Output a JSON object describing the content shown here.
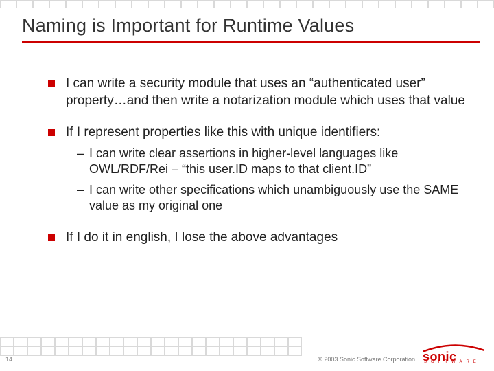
{
  "title": "Naming is Important for Runtime Values",
  "bullets": {
    "b1": "I can write a security module that uses an “authenticated user” property…and then write a notarization module which uses that value",
    "b2": "If I represent properties like this with unique identifiers:",
    "b3": "If I do it in english, I lose the above advantages"
  },
  "subs": {
    "s1": "I can write clear assertions in higher-level languages like OWL/RDF/Rei – “this user.ID maps to that client.ID”",
    "s2": "I can write other specifications which unambiguously use the SAME value as my original one"
  },
  "footer": {
    "page": "14",
    "copyright": "© 2003 Sonic Software Corporation"
  },
  "logo": {
    "main": "sonic",
    "sub": "SOFTWARE"
  }
}
